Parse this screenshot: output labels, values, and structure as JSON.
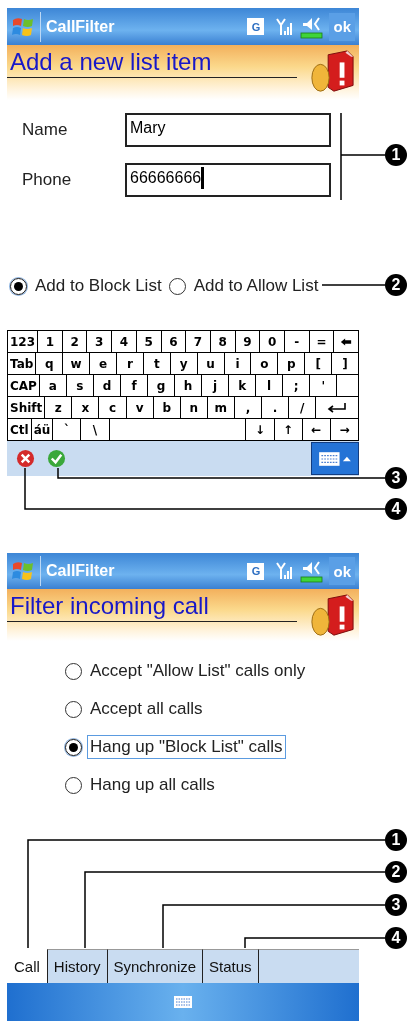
{
  "screens": [
    {
      "kind": "add_item",
      "title_bar": {
        "title": "CallFilter",
        "network": "G",
        "ok": "ok"
      },
      "header": {
        "title": "Add a new list item"
      },
      "fields": [
        {
          "label": "Name",
          "value": "Mary",
          "focused": false
        },
        {
          "label": "Phone",
          "value": "66666666",
          "focused": true
        }
      ],
      "options": [
        {
          "label": "Add to Block List",
          "selected": true,
          "focused": false
        },
        {
          "label": "Add to Allow List",
          "selected": false,
          "focused": false
        }
      ],
      "keyboard": [
        [
          {
            "kind": "mod",
            "label": "123"
          },
          {
            "kind": "key",
            "label": "1"
          },
          {
            "kind": "key",
            "label": "2"
          },
          {
            "kind": "key",
            "label": "3"
          },
          {
            "kind": "key",
            "label": "4"
          },
          {
            "kind": "key",
            "label": "5"
          },
          {
            "kind": "key",
            "label": "6"
          },
          {
            "kind": "key",
            "label": "7"
          },
          {
            "kind": "key",
            "label": "8"
          },
          {
            "kind": "key",
            "label": "9"
          },
          {
            "kind": "key",
            "label": "0"
          },
          {
            "kind": "key",
            "label": "-"
          },
          {
            "kind": "key",
            "label": "="
          },
          {
            "kind": "backspace"
          }
        ],
        [
          {
            "kind": "mod",
            "label": "Tab"
          },
          {
            "kind": "key",
            "label": "q"
          },
          {
            "kind": "key",
            "label": "w"
          },
          {
            "kind": "key",
            "label": "e"
          },
          {
            "kind": "key",
            "label": "r"
          },
          {
            "kind": "key",
            "label": "t"
          },
          {
            "kind": "key",
            "label": "y"
          },
          {
            "kind": "key",
            "label": "u"
          },
          {
            "kind": "key",
            "label": "i"
          },
          {
            "kind": "key",
            "label": "o"
          },
          {
            "kind": "key",
            "label": "p"
          },
          {
            "kind": "key",
            "label": "["
          },
          {
            "kind": "key",
            "label": "]"
          }
        ],
        [
          {
            "kind": "mod",
            "label": "CAP"
          },
          {
            "kind": "key",
            "label": "a"
          },
          {
            "kind": "key",
            "label": "s"
          },
          {
            "kind": "key",
            "label": "d"
          },
          {
            "kind": "key",
            "label": "f"
          },
          {
            "kind": "key",
            "label": "g"
          },
          {
            "kind": "key",
            "label": "h"
          },
          {
            "kind": "key",
            "label": "j"
          },
          {
            "kind": "key",
            "label": "k"
          },
          {
            "kind": "key",
            "label": "l"
          },
          {
            "kind": "key",
            "label": ";"
          },
          {
            "kind": "key",
            "label": "'"
          },
          {
            "kind": "blank"
          }
        ],
        [
          {
            "kind": "mod",
            "label": "Shift"
          },
          {
            "kind": "key",
            "label": "z"
          },
          {
            "kind": "key",
            "label": "x"
          },
          {
            "kind": "key",
            "label": "c"
          },
          {
            "kind": "key",
            "label": "v"
          },
          {
            "kind": "key",
            "label": "b"
          },
          {
            "kind": "key",
            "label": "n"
          },
          {
            "kind": "key",
            "label": "m"
          },
          {
            "kind": "key",
            "label": ","
          },
          {
            "kind": "key",
            "label": "."
          },
          {
            "kind": "key",
            "label": "/"
          },
          {
            "kind": "enter"
          }
        ],
        [
          {
            "kind": "mod",
            "label": "Ctl"
          },
          {
            "kind": "mod",
            "label": "áü"
          },
          {
            "kind": "key",
            "label": "`"
          },
          {
            "kind": "key",
            "label": "\\"
          },
          {
            "kind": "space"
          },
          {
            "kind": "key",
            "label": "↓"
          },
          {
            "kind": "key",
            "label": "↑"
          },
          {
            "kind": "key",
            "label": "←"
          },
          {
            "kind": "key",
            "label": "→"
          }
        ]
      ],
      "callouts": [
        "1",
        "2",
        "3",
        "4"
      ]
    },
    {
      "kind": "filter",
      "title_bar": {
        "title": "CallFilter",
        "network": "G",
        "ok": "ok"
      },
      "header": {
        "title": "Filter incoming call"
      },
      "options": [
        {
          "label": "Accept \"Allow List\" calls only",
          "selected": false,
          "focused": false
        },
        {
          "label": "Accept all calls",
          "selected": false,
          "focused": false
        },
        {
          "label": "Hang up \"Block List\" calls",
          "selected": true,
          "focused": true
        },
        {
          "label": "Hang up all calls",
          "selected": false,
          "focused": false
        }
      ],
      "tabs": [
        {
          "label": "Call",
          "selected": true
        },
        {
          "label": "History",
          "selected": false
        },
        {
          "label": "Synchronize",
          "selected": false
        },
        {
          "label": "Status",
          "selected": false
        }
      ],
      "callouts": [
        "1",
        "2",
        "3",
        "4"
      ]
    }
  ]
}
